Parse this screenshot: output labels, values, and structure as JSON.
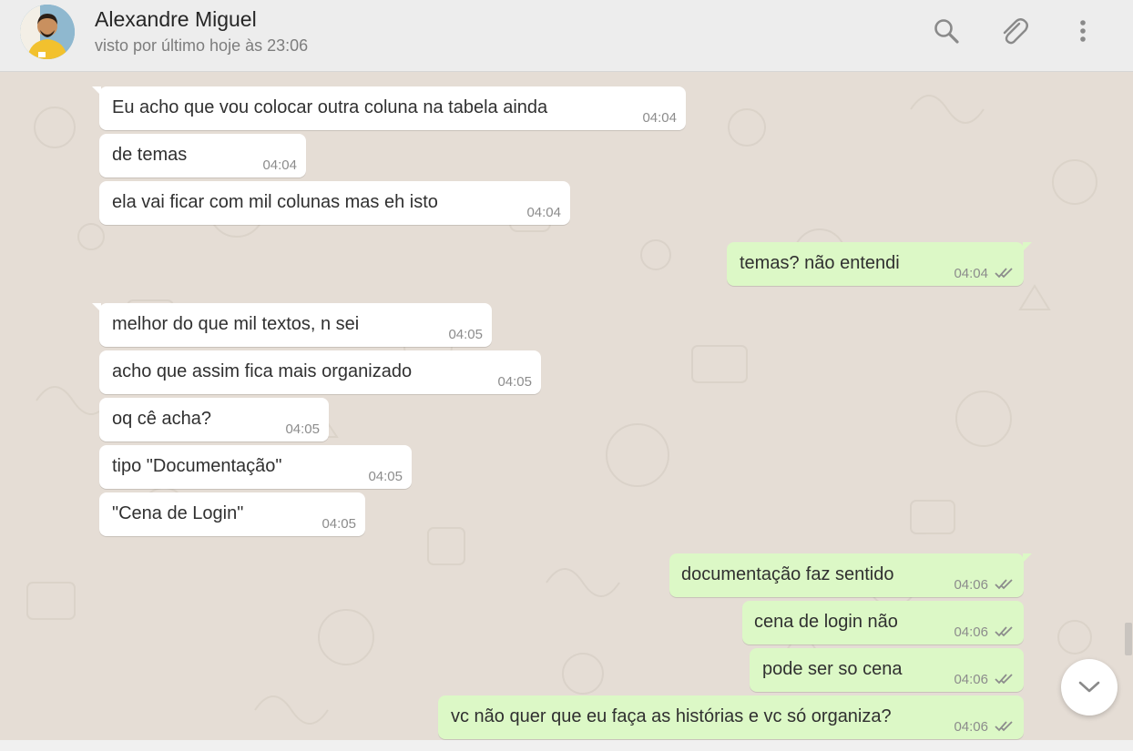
{
  "contact": {
    "name": "Alexandre Miguel",
    "status": "visto por último hoje às 23:06",
    "avatar_icon": "person-avatar"
  },
  "header_actions": [
    {
      "icon": "search-icon"
    },
    {
      "icon": "paperclip-icon"
    },
    {
      "icon": "kebab-menu-icon"
    }
  ],
  "colors": {
    "incoming_bubble": "#ffffff",
    "outgoing_bubble": "#dcf8c6",
    "wallpaper": "#e5ddd5",
    "header": "#ededed",
    "read_ticks": "#4fc3f7"
  },
  "messages": [
    {
      "dir": "in",
      "text": "Eu acho que vou colocar outra coluna na tabela ainda",
      "time": "04:04"
    },
    {
      "dir": "in",
      "text": "de temas",
      "time": "04:04"
    },
    {
      "dir": "in",
      "text": "ela vai ficar com mil colunas mas eh isto",
      "time": "04:04"
    },
    {
      "dir": "out",
      "text": "temas? não entendi",
      "time": "04:04"
    },
    {
      "dir": "in",
      "text": "melhor do que mil textos, n sei",
      "time": "04:05"
    },
    {
      "dir": "in",
      "text": "acho que assim fica mais organizado",
      "time": "04:05"
    },
    {
      "dir": "in",
      "text": "oq cê acha?",
      "time": "04:05"
    },
    {
      "dir": "in",
      "text": "tipo \"Documentação\"",
      "time": "04:05"
    },
    {
      "dir": "in",
      "text": "\"Cena de Login\"",
      "time": "04:05"
    },
    {
      "dir": "out",
      "text": "documentação faz sentido",
      "time": "04:06"
    },
    {
      "dir": "out",
      "text": "cena de login não",
      "time": "04:06"
    },
    {
      "dir": "out",
      "text": "pode ser so cena",
      "time": "04:06"
    },
    {
      "dir": "out",
      "text": "vc não quer que eu faça as histórias e vc só organiza?",
      "time": "04:06"
    }
  ],
  "scroll_button": {
    "icon": "chevron-down-icon"
  }
}
